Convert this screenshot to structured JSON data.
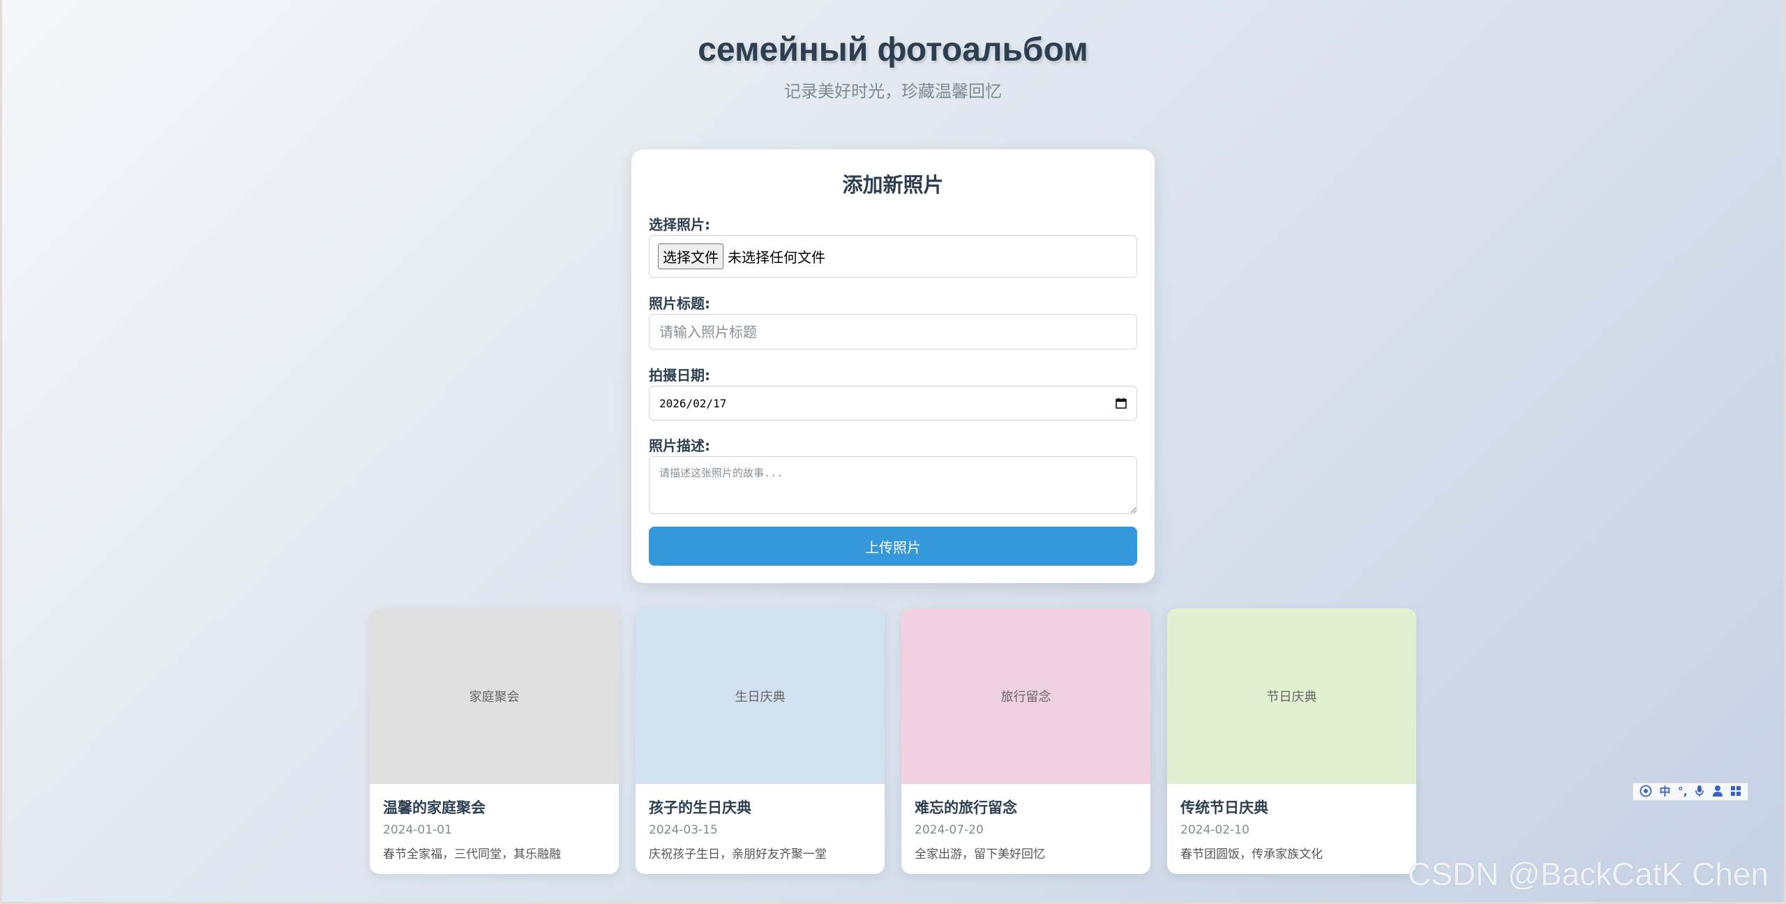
{
  "header": {
    "title": "семейный фотоальбом",
    "subtitle": "记录美好时光，珍藏温馨回忆"
  },
  "upload_form": {
    "heading": "添加新照片",
    "file_label": "选择照片:",
    "file_button": "选择文件",
    "file_status": "未选择任何文件",
    "title_label": "照片标题:",
    "title_placeholder": "请输入照片标题",
    "date_label": "拍摄日期:",
    "date_value": "2026/02/17",
    "desc_label": "照片描述:",
    "desc_placeholder": "请描述这张照片的故事...",
    "submit_label": "上传照片"
  },
  "photos": [
    {
      "thumb_label": "家庭聚会",
      "title": "温馨的家庭聚会",
      "date": "2024-01-01",
      "desc": "春节全家福，三代同堂，其乐融融",
      "color": "#e0e0e0"
    },
    {
      "thumb_label": "生日庆典",
      "title": "孩子的生日庆典",
      "date": "2024-03-15",
      "desc": "庆祝孩子生日，亲朋好友齐聚一堂",
      "color": "#d1e1f0"
    },
    {
      "thumb_label": "旅行留念",
      "title": "难忘的旅行留念",
      "date": "2024-07-20",
      "desc": "全家出游，留下美好回忆",
      "color": "#f0d1e1"
    },
    {
      "thumb_label": "节日庆典",
      "title": "传统节日庆典",
      "date": "2024-02-10",
      "desc": "春节团圆饭，传承家族文化",
      "color": "#e1f0d1"
    }
  ],
  "ime_toolbar": {
    "items": [
      "logo-icon",
      "中",
      "punctuation-icon",
      "microphone-icon",
      "user-icon",
      "grid-icon"
    ],
    "lang_label": "中"
  },
  "watermark": "CSDN @BackCatK Chen",
  "colors": {
    "accent": "#3498db",
    "title_text": "#2c3e50",
    "muted_text": "#7f8c8d"
  }
}
